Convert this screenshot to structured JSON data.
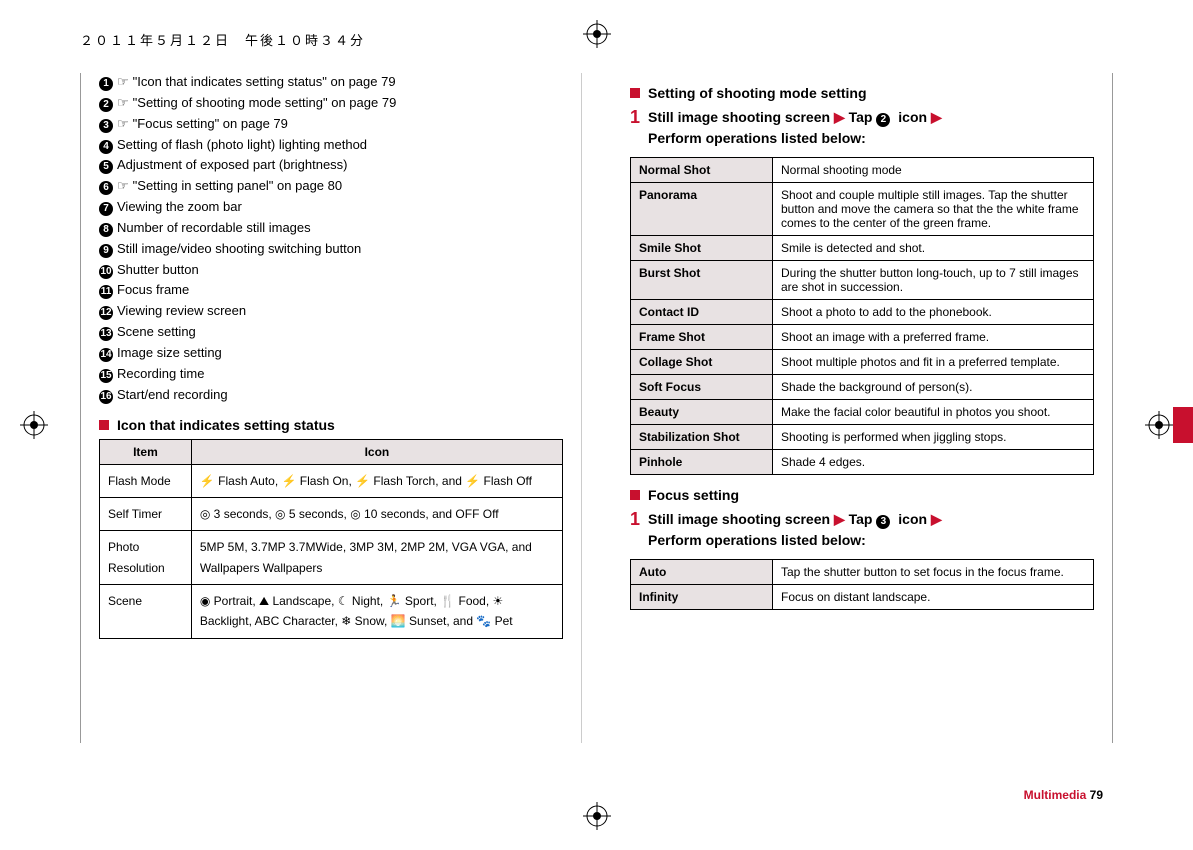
{
  "header_date": "２０１１年５月１２日　午後１０時３４分",
  "left": {
    "items": [
      {
        "num": "1",
        "link": true,
        "text": "\"Icon that indicates setting status\" on page 79"
      },
      {
        "num": "2",
        "link": true,
        "text": "\"Setting of shooting mode setting\" on page 79"
      },
      {
        "num": "3",
        "link": true,
        "text": "\"Focus setting\" on page 79"
      },
      {
        "num": "4",
        "link": false,
        "text": "Setting of flash (photo light) lighting method"
      },
      {
        "num": "5",
        "link": false,
        "text": "Adjustment of exposed part (brightness)"
      },
      {
        "num": "6",
        "link": true,
        "text": "\"Setting in setting panel\" on page 80"
      },
      {
        "num": "7",
        "link": false,
        "text": "Viewing the zoom bar"
      },
      {
        "num": "8",
        "link": false,
        "text": "Number of recordable still images"
      },
      {
        "num": "9",
        "link": false,
        "text": "Still image/video shooting switching button"
      },
      {
        "num": "10",
        "link": false,
        "text": "Shutter button"
      },
      {
        "num": "11",
        "link": false,
        "text": "Focus frame"
      },
      {
        "num": "12",
        "link": false,
        "text": "Viewing review screen"
      },
      {
        "num": "13",
        "link": false,
        "text": "Scene setting"
      },
      {
        "num": "14",
        "link": false,
        "text": "Image size setting"
      },
      {
        "num": "15",
        "link": false,
        "text": "Recording time"
      },
      {
        "num": "16",
        "link": false,
        "text": "Start/end recording"
      }
    ],
    "icon_heading": "Icon that indicates setting status",
    "icon_table": {
      "headers": {
        "item": "Item",
        "icon": "Icon"
      },
      "rows": [
        {
          "item": "Flash Mode",
          "icon": "⚡ Flash Auto, ⚡ Flash On, ⚡ Flash Torch, and ⚡ Flash Off"
        },
        {
          "item": "Self Timer",
          "icon": "◎ 3 seconds, ◎ 5 seconds, ◎ 10 seconds, and OFF Off"
        },
        {
          "item": "Photo Resolution",
          "icon": "5MP 5M, 3.7MP 3.7MWide, 3MP 3M, 2MP 2M, VGA VGA, and Wallpapers Wallpapers"
        },
        {
          "item": "Scene",
          "icon": "◉ Portrait, ⛰ Landscape, ☾ Night, 🏃 Sport, 🍴 Food, ☀ Backlight, ABC Character, ❄ Snow, 🌅 Sunset, and 🐾 Pet"
        }
      ]
    }
  },
  "right": {
    "sec1": {
      "heading": "Setting of shooting mode setting",
      "step_prefix": "Still image shooting screen ",
      "step_mid": " Tap ",
      "step_icon_num": "2",
      "step_end": " icon ",
      "step_line2": "Perform operations listed below:",
      "rows": [
        {
          "label": "Normal Shot",
          "desc": "Normal shooting mode"
        },
        {
          "label": "Panorama",
          "desc": "Shoot and couple multiple still images. Tap the shutter button and move the camera so that the the white frame comes to the center of the green frame."
        },
        {
          "label": "Smile Shot",
          "desc": "Smile is detected and shot."
        },
        {
          "label": "Burst Shot",
          "desc": "During the shutter button long-touch, up to 7 still images are shot in succession."
        },
        {
          "label": "Contact ID",
          "desc": "Shoot a photo to add to the phonebook."
        },
        {
          "label": "Frame Shot",
          "desc": "Shoot an image with a preferred frame."
        },
        {
          "label": "Collage Shot",
          "desc": "Shoot multiple photos and fit in a preferred template."
        },
        {
          "label": "Soft Focus",
          "desc": "Shade the background of person(s)."
        },
        {
          "label": "Beauty",
          "desc": "Make the facial color beautiful in photos you shoot."
        },
        {
          "label": "Stabilization Shot",
          "desc": "Shooting is performed when jiggling stops."
        },
        {
          "label": "Pinhole",
          "desc": "Shade 4 edges."
        }
      ]
    },
    "sec2": {
      "heading": "Focus setting",
      "step_prefix": "Still image shooting screen ",
      "step_mid": " Tap ",
      "step_icon_num": "3",
      "step_end": " icon ",
      "step_line2": "Perform operations listed below:",
      "rows": [
        {
          "label": "Auto",
          "desc": "Tap the shutter button to set focus in the focus frame."
        },
        {
          "label": "Infinity",
          "desc": "Focus on distant landscape."
        }
      ]
    }
  },
  "footer": {
    "section": "Multimedia",
    "page": "79"
  }
}
